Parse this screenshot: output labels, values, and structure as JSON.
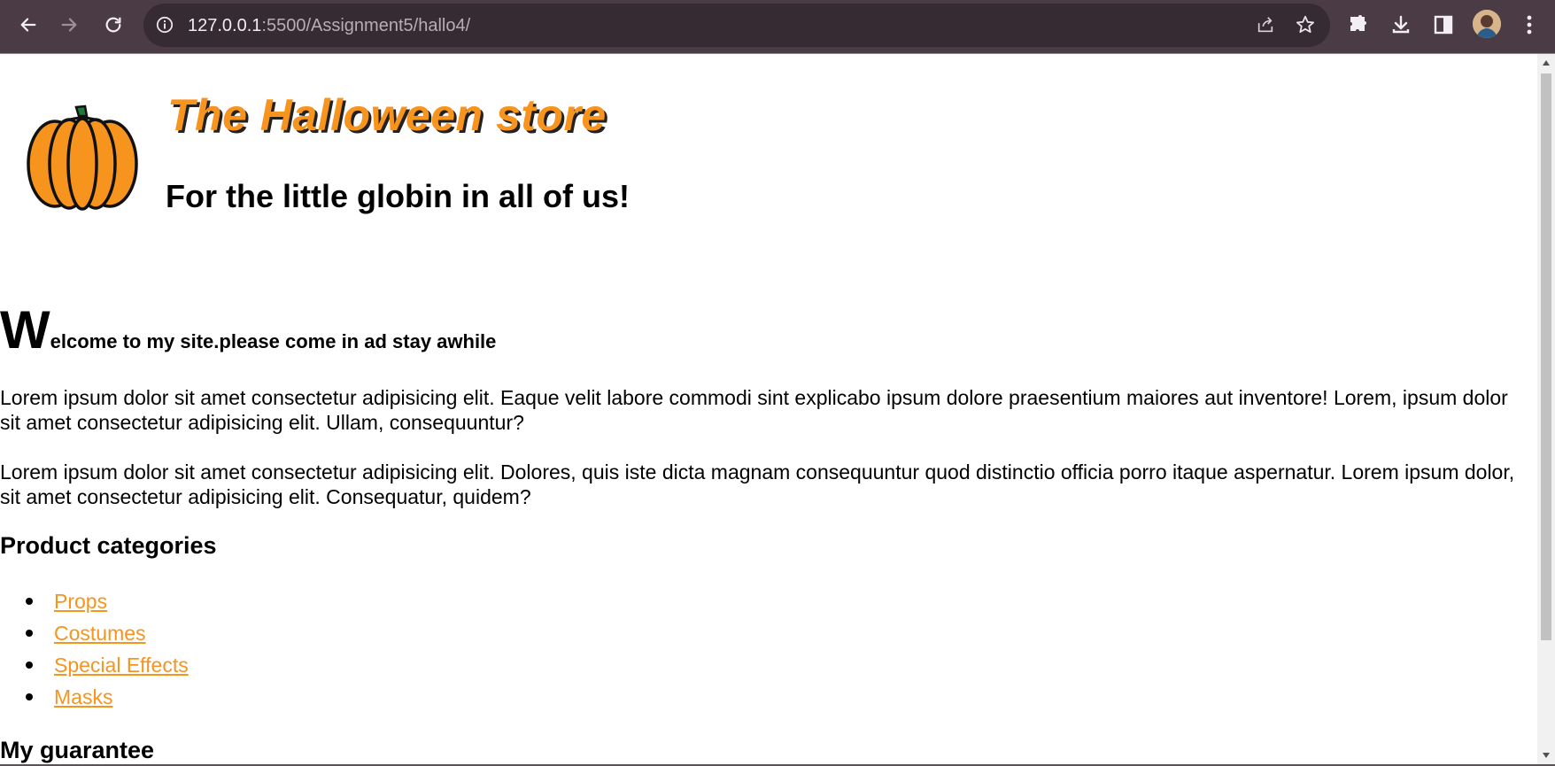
{
  "browser": {
    "url_host": "127.0.0.1",
    "url_rest": ":5500/Assignment5/hallo4/"
  },
  "page": {
    "store_title": "The Halloween store",
    "tagline": "For the little globin in all of us!",
    "welcome_initial": "W",
    "welcome_rest": "elcome to my site.please come in ad stay awhile",
    "paragraphs": [
      "Lorem ipsum dolor sit amet consectetur adipisicing elit. Eaque velit labore commodi sint explicabo ipsum dolore praesentium maiores aut inventore! Lorem, ipsum dolor sit amet consectetur adipisicing elit. Ullam, consequuntur?",
      "Lorem ipsum dolor sit amet consectetur adipisicing elit. Dolores, quis iste dicta magnam consequuntur quod distinctio officia porro itaque aspernatur. Lorem ipsum dolor, sit amet consectetur adipisicing elit. Consequatur, quidem?"
    ],
    "categories_heading": "Product categories",
    "categories": [
      "Props",
      "Costumes",
      "Special Effects",
      "Masks"
    ],
    "guarantee_heading": "My guarantee"
  },
  "colors": {
    "accent": "#f7941d",
    "toolbar": "#4b3b45"
  }
}
